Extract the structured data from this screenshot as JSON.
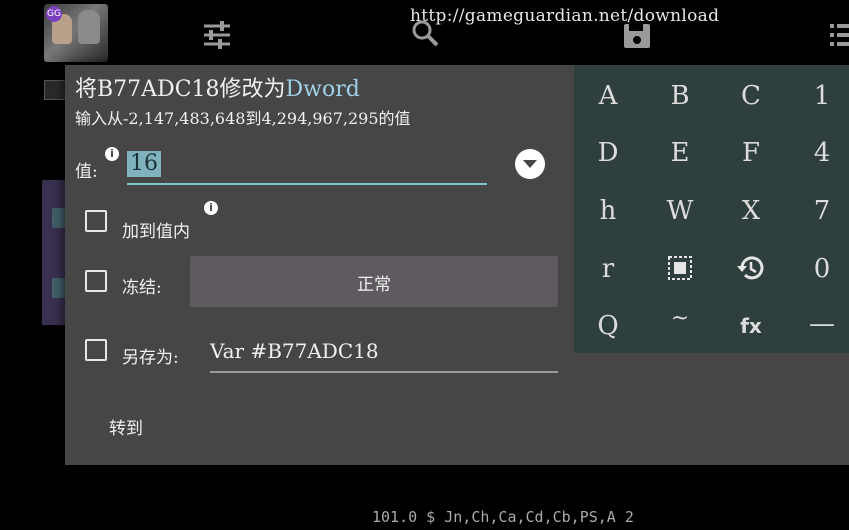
{
  "background": {
    "url": "http://gameguardian.net/download",
    "bottom_text": "101.0 $ Jn,Ch,Ca,Cd,Cb,PS,A 2",
    "avatar_badge": "GG",
    "toolbar_icons": [
      "sliders-icon",
      "search-icon",
      "save-icon",
      "list-icon"
    ]
  },
  "dialog": {
    "title_prefix": "将B77ADC18修改为",
    "title_type": "Dword",
    "subtitle": "输入从-2,147,483,648到4,294,967,295的值",
    "value_label": "值:",
    "value": "16",
    "add_to_value_label": "加到值内",
    "freeze_label": "冻结:",
    "freeze_option": "正常",
    "save_as_label": "另存为:",
    "save_as_value": "Var #B77ADC18",
    "goto_label": "转到"
  },
  "keypad": {
    "keys": [
      "A",
      "B",
      "C",
      "1",
      "D",
      "E",
      "F",
      "4",
      "h",
      "W",
      "X",
      "7",
      "r",
      "select-all-icon",
      "history-icon",
      "0",
      "Q",
      "~",
      "fx",
      "—"
    ]
  },
  "colors": {
    "dialog_bg": "#464646",
    "keypad_bg": "#2f3f3e",
    "accent": "#7ec8c8",
    "title_accent": "#9fd0e8"
  }
}
